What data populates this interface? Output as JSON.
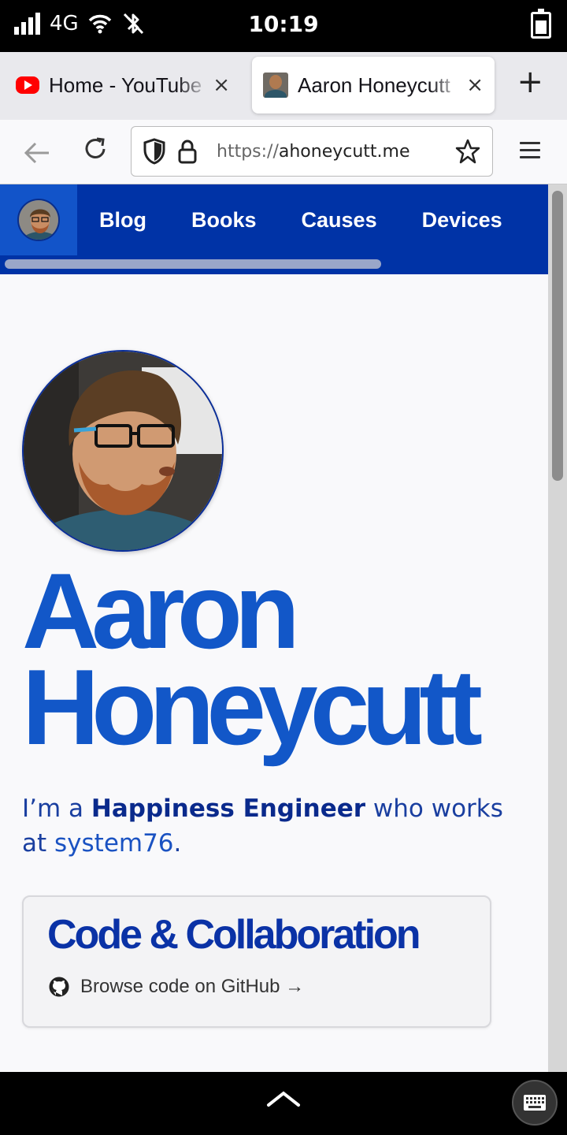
{
  "status": {
    "network": "4G",
    "time": "10:19"
  },
  "tabs": [
    {
      "title": "Home - YouTube",
      "close": "×"
    },
    {
      "title": "Aaron Honeycutt",
      "close": "×"
    }
  ],
  "new_tab": "+",
  "url": {
    "scheme": "https://",
    "host": "ahoneycutt.me"
  },
  "site": {
    "nav": [
      "Blog",
      "Books",
      "Causes",
      "Devices"
    ],
    "name_line1": "Aaron",
    "name_line2": "Honeycutt",
    "tagline": {
      "prefix": "I’m a ",
      "role": "Happiness Engineer",
      "middle": " who works at ",
      "company": "system76",
      "suffix": "."
    },
    "card": {
      "title": "Code & Collaboration",
      "link": "Browse code on GitHub →"
    }
  },
  "colors": {
    "nav_bg": "#0033a6",
    "accent": "#1257c8"
  }
}
